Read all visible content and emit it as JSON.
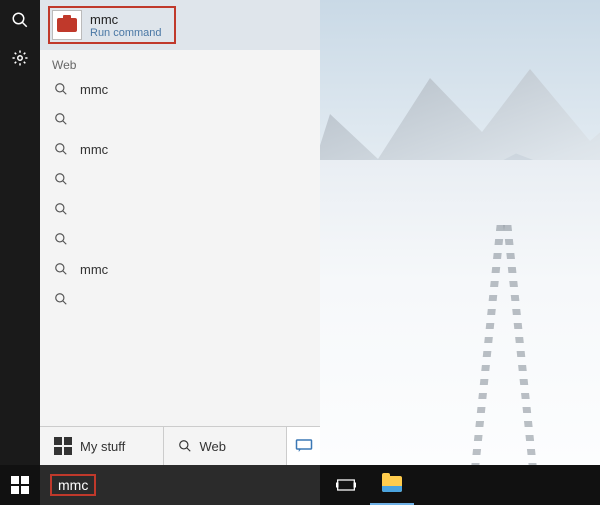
{
  "sidebar": {
    "search_icon": "search-icon",
    "settings_icon": "settings-icon"
  },
  "best_match": {
    "title": "mmc",
    "subtitle": "Run command"
  },
  "web_section_label": "Web",
  "web_suggestions": [
    {
      "text": "mmc"
    },
    {
      "text": ""
    },
    {
      "text": "mmc"
    },
    {
      "text": ""
    },
    {
      "text": ""
    },
    {
      "text": ""
    },
    {
      "text": "mmc"
    },
    {
      "text": ""
    }
  ],
  "filters": {
    "mystuff_label": "My stuff",
    "web_label": "Web"
  },
  "search_value": "mmc",
  "colors": {
    "highlight_border": "#c0392b",
    "link_blue": "#4a78a5"
  }
}
